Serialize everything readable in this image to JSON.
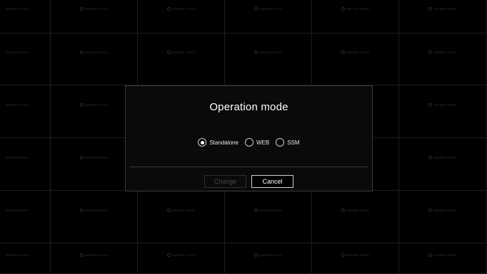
{
  "watermark": {
    "text": "Hanwha Vision"
  },
  "dialog": {
    "title": "Operation mode",
    "options": [
      {
        "label": "Standalone",
        "selected": true
      },
      {
        "label": "WEB",
        "selected": false
      },
      {
        "label": "SSM",
        "selected": false
      }
    ],
    "change_label": "Change",
    "change_enabled": false,
    "cancel_label": "Cancel"
  },
  "colors": {
    "background": "#000000",
    "dialog_background": "#0a0a0a",
    "dialog_border": "#3a3a3a",
    "text": "#ffffff",
    "disabled_text": "#4a4a4a"
  }
}
